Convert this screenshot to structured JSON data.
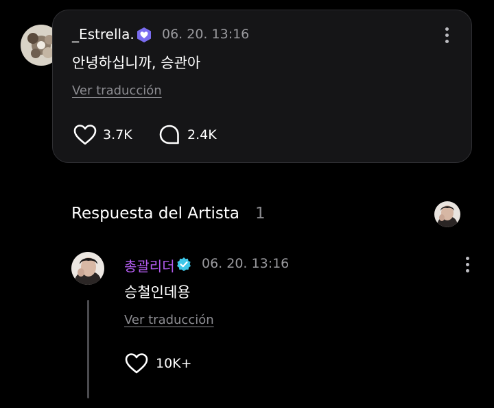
{
  "post": {
    "username": "_Estrella.",
    "timestamp": "06. 20. 13:16",
    "message": "안녕하십니까, 승관아",
    "translate_label": "Ver traducción",
    "likes": "3.7K",
    "comments": "2.4K"
  },
  "artist_section": {
    "title": "Respuesta del Artista",
    "count": "1"
  },
  "reply": {
    "username": "총괄리더",
    "timestamp": "06. 20. 13:16",
    "message": "승철인데용",
    "translate_label": "Ver traducción",
    "likes": "10K+"
  },
  "colors": {
    "background": "#000000",
    "card": "#151517",
    "artist_name": "#b35cf0",
    "verified_badge": "#3ec7e8",
    "fan_badge": "#7a6cf0"
  },
  "icons": [
    "more-vertical-icon",
    "heart-icon",
    "comment-bubble-icon",
    "verified-badge-icon",
    "fan-badge-icon"
  ]
}
